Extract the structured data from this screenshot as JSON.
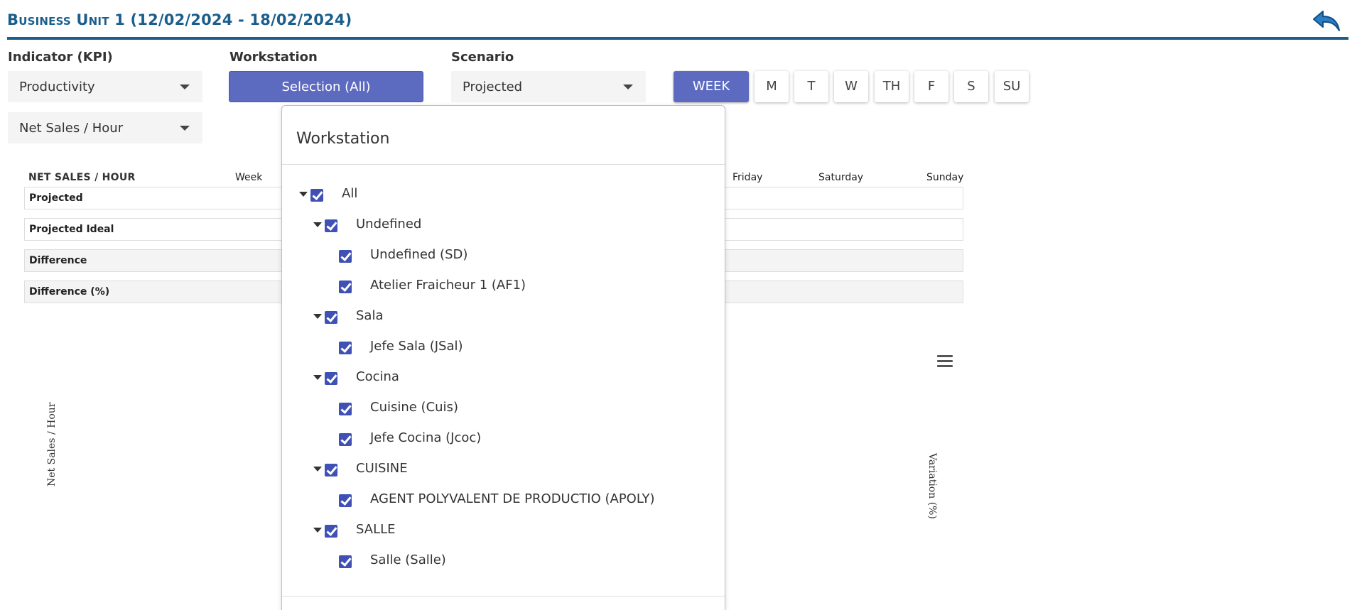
{
  "header": {
    "title": "Business Unit 1 (12/02/2024 - 18/02/2024)",
    "back_icon": "back-arrow-icon"
  },
  "filters": {
    "indicator_label": "Indicator (KPI)",
    "indicator_value": "Productivity",
    "kpi_value": "Net Sales / Hour",
    "workstation_label": "Workstation",
    "workstation_button": "Selection (All)",
    "scenario_label": "Scenario",
    "scenario_value": "Projected"
  },
  "days": [
    "WEEK",
    "M",
    "T",
    "W",
    "TH",
    "F",
    "S",
    "SU"
  ],
  "active_day": "WEEK",
  "table": {
    "title": "NET SALES / HOUR",
    "columns": [
      "Week",
      "Friday",
      "Saturday",
      "Sunday"
    ],
    "rows": [
      "Projected",
      "Projected Ideal",
      "Difference",
      "Difference (%)"
    ]
  },
  "chart": {
    "y_left_label": "Net Sales / Hour",
    "y_right_label": "Variation (%)",
    "menu_icon": "hamburger-menu-icon"
  },
  "popup": {
    "title": "Workstation",
    "tree": [
      {
        "label": "All",
        "level": 0,
        "expandable": true,
        "checked": true
      },
      {
        "label": "Undefined",
        "level": 1,
        "expandable": true,
        "checked": true
      },
      {
        "label": "Undefined (SD)",
        "level": 2,
        "expandable": false,
        "checked": true
      },
      {
        "label": "Atelier Fraicheur 1 (AF1)",
        "level": 2,
        "expandable": false,
        "checked": true
      },
      {
        "label": "Sala",
        "level": 1,
        "expandable": true,
        "checked": true
      },
      {
        "label": "Jefe Sala (JSal)",
        "level": 2,
        "expandable": false,
        "checked": true
      },
      {
        "label": "Cocina",
        "level": 1,
        "expandable": true,
        "checked": true
      },
      {
        "label": "Cuisine (Cuis)",
        "level": 2,
        "expandable": false,
        "checked": true
      },
      {
        "label": "Jefe Cocina (Jcoc)",
        "level": 2,
        "expandable": false,
        "checked": true
      },
      {
        "label": "CUISINE",
        "level": 1,
        "expandable": true,
        "checked": true
      },
      {
        "label": "AGENT POLYVALENT DE PRODUCTIO (APOLY)",
        "level": 2,
        "expandable": false,
        "checked": true
      },
      {
        "label": "SALLE",
        "level": 1,
        "expandable": true,
        "checked": true
      },
      {
        "label": "Salle (Salle)",
        "level": 2,
        "expandable": false,
        "checked": true
      }
    ]
  },
  "colors": {
    "brand": "#1b5e8c",
    "accent": "#5c6bc0",
    "checkbox": "#3f51b5"
  }
}
